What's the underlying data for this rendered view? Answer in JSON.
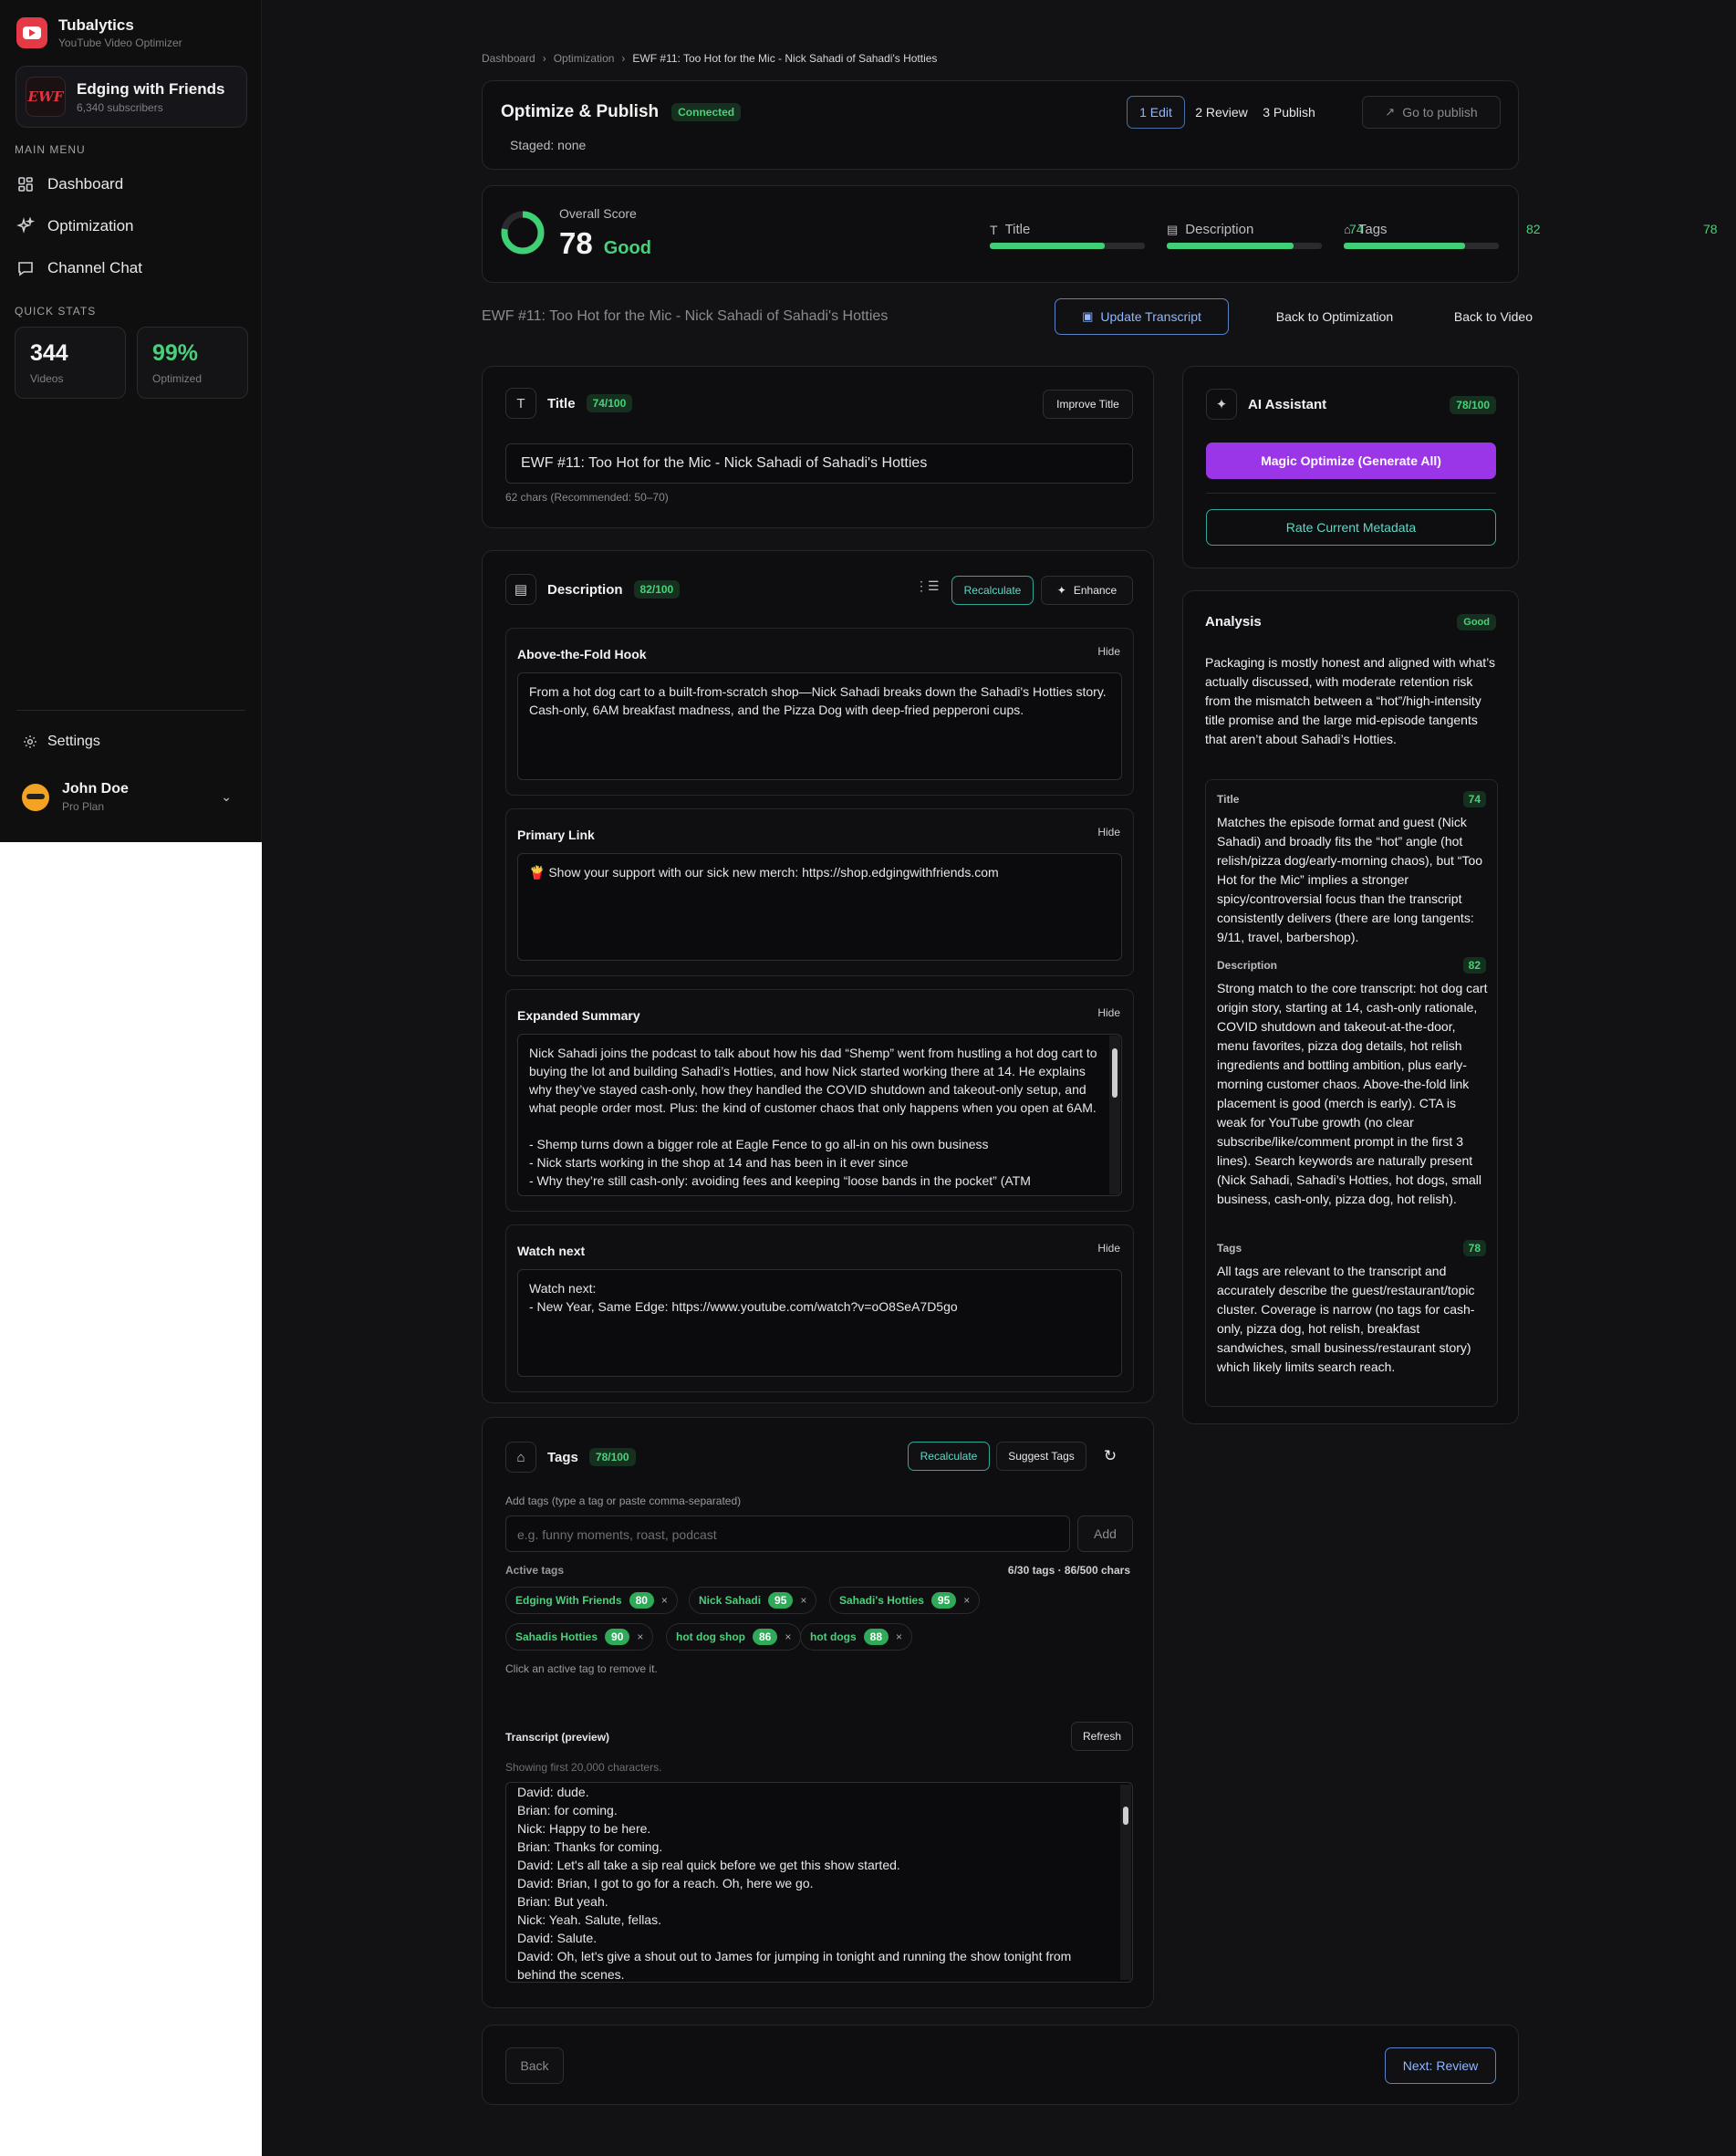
{
  "brand": {
    "name": "Tubalytics",
    "subtitle": "YouTube Video Optimizer"
  },
  "channel": {
    "avatar_text": "EWF",
    "name": "Edging with Friends",
    "subscribers": "6,340 subscribers"
  },
  "sidebar": {
    "main_menu_label": "MAIN MENU",
    "items": [
      {
        "label": "Dashboard",
        "icon": "grid-icon"
      },
      {
        "label": "Optimization",
        "icon": "sparkles-icon"
      },
      {
        "label": "Channel Chat",
        "icon": "chat-icon"
      }
    ],
    "quick_stats_label": "QUICK STATS",
    "stats": [
      {
        "value": "344",
        "label": "Videos"
      },
      {
        "value": "99%",
        "label": "Optimized"
      }
    ],
    "settings_label": "Settings",
    "user": {
      "name": "John Doe",
      "plan": "Pro Plan"
    }
  },
  "breadcrumb": {
    "items": [
      "Dashboard",
      "Optimization"
    ],
    "current": "EWF #11: Too Hot for the Mic - Nick Sahadi of Sahadi's Hotties",
    "separator": "›"
  },
  "header": {
    "title": "Optimize & Publish",
    "status": "Connected",
    "staged": "Staged: none",
    "steps": [
      "1 Edit",
      "2 Review",
      "3 Publish"
    ],
    "go_publish": "Go to publish"
  },
  "score": {
    "label": "Overall Score",
    "value": "78",
    "value_fraction": 0.78,
    "grade": "Good",
    "bars": [
      {
        "label": "Title",
        "value": "74",
        "fraction": 0.74,
        "icon": "text-icon"
      },
      {
        "label": "Description",
        "value": "82",
        "fraction": 0.82,
        "icon": "document-icon"
      },
      {
        "label": "Tags",
        "value": "78",
        "fraction": 0.78,
        "icon": "tag-icon"
      }
    ]
  },
  "video_title_line": "EWF #11: Too Hot for the Mic - Nick Sahadi of Sahadi's Hotties",
  "actions": {
    "update_transcript": "Update Transcript",
    "back_optimization": "Back to Optimization",
    "back_video": "Back to Video"
  },
  "title_section": {
    "label": "Title",
    "score": "74/100",
    "improve": "Improve Title",
    "value": "EWF #11: Too Hot for the Mic - Nick Sahadi of Sahadi's Hotties",
    "hint": "62 chars (Recommended: 50–70)"
  },
  "description_section": {
    "label": "Description",
    "score": "82/100",
    "recalculate": "Recalculate",
    "enhance": "Enhance",
    "hide_label": "Hide",
    "blocks": [
      {
        "title": "Above-the-Fold Hook",
        "text": "From a hot dog cart to a built-from-scratch shop—Nick Sahadi breaks down the Sahadi's Hotties story.\nCash-only, 6AM breakfast madness, and the Pizza Dog with deep-fried pepperoni cups."
      },
      {
        "title": "Primary Link",
        "text": "🍟 Show your support with our sick new merch: https://shop.edgingwithfriends.com"
      },
      {
        "title": "Expanded Summary",
        "text": "Nick Sahadi joins the podcast to talk about how his dad “Shemp” went from hustling a hot dog cart to buying the lot and building Sahadi’s Hotties, and how Nick started working there at 14. He explains why they’ve stayed cash-only, how they handled the COVID shutdown and takeout-only setup, and what people order most. Plus: the kind of customer chaos that only happens when you open at 6AM.\n\n- Shemp turns down a bigger role at Eagle Fence to go all-in on his own business\n- Nick starts working in the shop at 14 and has been in it ever since\n- Why they’re still cash-only: avoiding fees and keeping “loose bands in the pocket” (ATM"
      },
      {
        "title": "Watch next",
        "text": "Watch next:\n- New Year, Same Edge: https://www.youtube.com/watch?v=oO8SeA7D5go"
      }
    ]
  },
  "tags_section": {
    "label": "Tags",
    "score": "78/100",
    "recalculate": "Recalculate",
    "suggest": "Suggest Tags",
    "add_label": "Add tags (type a tag or paste comma-separated)",
    "placeholder": "e.g. funny moments, roast, podcast",
    "add_button": "Add",
    "active_label": "Active tags",
    "count": "6/30 tags · 86/500 chars",
    "tags": [
      {
        "name": "Edging With Friends",
        "score": "80"
      },
      {
        "name": "Nick Sahadi",
        "score": "95"
      },
      {
        "name": "Sahadi's Hotties",
        "score": "95"
      },
      {
        "name": "Sahadis Hotties",
        "score": "90"
      },
      {
        "name": "hot dog shop",
        "score": "86"
      },
      {
        "name": "hot dogs",
        "score": "88"
      }
    ],
    "remove_glyph": "×",
    "remove_hint": "Click an active tag to remove it."
  },
  "transcript": {
    "label": "Transcript (preview)",
    "refresh": "Refresh",
    "hint": "Showing first 20,000 characters.",
    "text": "David: dude.\nBrian: for coming.\nNick: Happy to be here.\nBrian: Thanks for coming.\nDavid: Let's all take a sip real quick before we get this show started.\nDavid: Brian, I got to go for a reach. Oh, here we go.\nBrian: But yeah.\nNick: Yeah. Salute, fellas.\nDavid: Salute.\nDavid: Oh, let's give a shout out to James for jumping in tonight and running the show tonight from behind the scenes.\nDavid: Let's dive right in, dude."
  },
  "footer": {
    "back": "Back",
    "next": "Next: Review"
  },
  "assistant": {
    "label": "AI Assistant",
    "score": "78/100",
    "magic": "Magic Optimize (Generate All)",
    "rate": "Rate Current Metadata"
  },
  "analysis": {
    "label": "Analysis",
    "badge": "Good",
    "summary": "Packaging is mostly honest and aligned with what’s actually discussed, with moderate retention risk from the mismatch between a “hot”/high-intensity title promise and the large mid-episode tangents that aren’t about Sahadi’s Hotties.",
    "items": [
      {
        "title": "Title",
        "score": "74",
        "text": "Matches the episode format and guest (Nick Sahadi) and broadly fits the “hot” angle (hot relish/pizza dog/early-morning chaos), but “Too Hot for the Mic” implies a stronger spicy/controversial focus than the transcript consistently delivers (there are long tangents: 9/11, travel, barbershop)."
      },
      {
        "title": "Description",
        "score": "82",
        "text": "Strong match to the core transcript: hot dog cart origin story, starting at 14, cash-only rationale, COVID shutdown and takeout-at-the-door, menu favorites, pizza dog details, hot relish ingredients and bottling ambition, plus early-morning customer chaos. Above-the-fold link placement is good (merch is early). CTA is weak for YouTube growth (no clear subscribe/like/comment prompt in the first 3 lines). Search keywords are naturally present (Nick Sahadi, Sahadi’s Hotties, hot dogs, small business, cash-only, pizza dog, hot relish)."
      },
      {
        "title": "Tags",
        "score": "78",
        "text": "All tags are relevant to the transcript and accurately describe the guest/restaurant/topic cluster. Coverage is narrow (no tags for cash-only, pizza dog, hot relish, breakfast sandwiches, small business/restaurant story) which likely limits search reach."
      }
    ]
  },
  "colors": {
    "accent_green": "#4ad07a",
    "accent_purple": "#9b35e8",
    "accent_teal": "#5fd9c6",
    "brand_red": "#e53945"
  }
}
